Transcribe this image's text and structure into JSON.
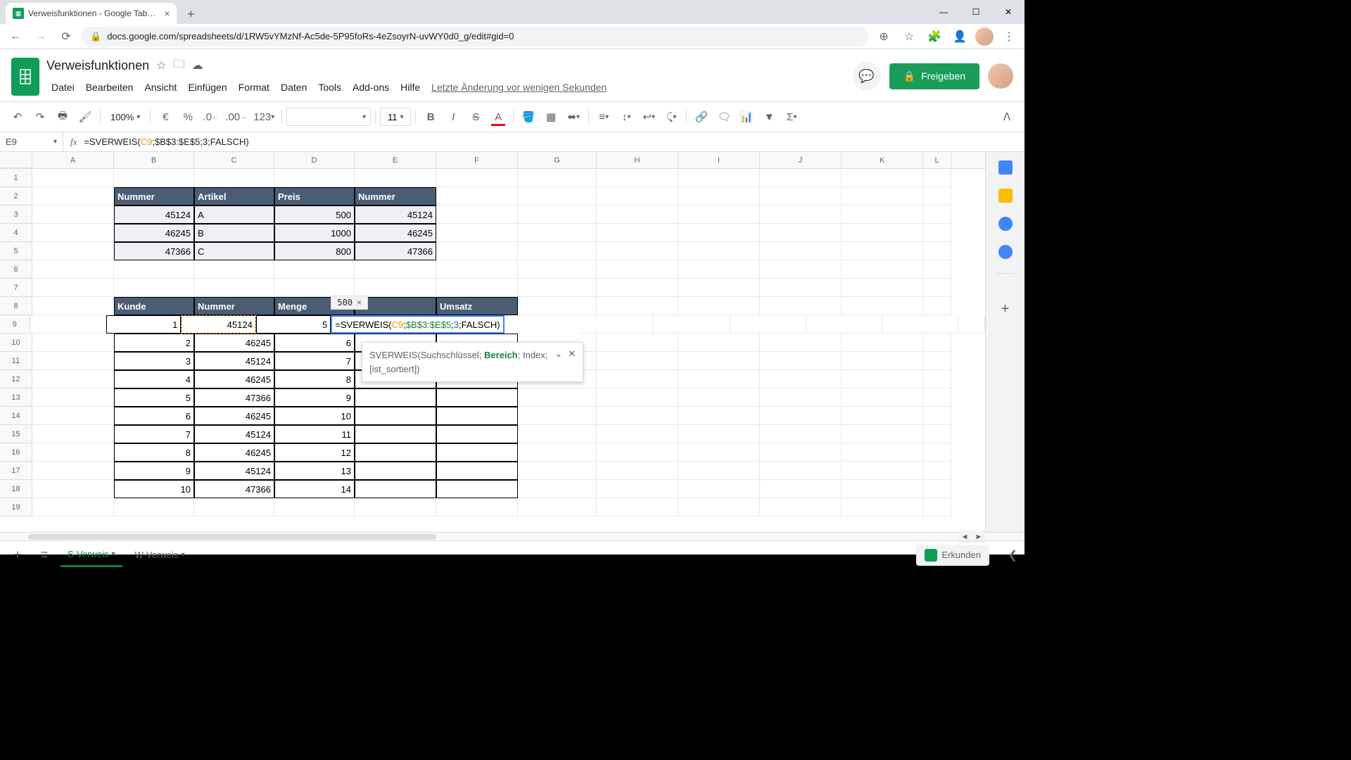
{
  "browser": {
    "tab_title": "Verweisfunktionen - Google Tab…",
    "url": "docs.google.com/spreadsheets/d/1RW5vYMzNf-Ac5de-5P95foRs-4eZsoyrN-uvWY0d0_g/edit#gid=0"
  },
  "doc": {
    "title": "Verweisfunktionen",
    "last_edit": "Letzte Änderung vor wenigen Sekunden",
    "share_label": "Freigeben"
  },
  "menus": [
    "Datei",
    "Bearbeiten",
    "Ansicht",
    "Einfügen",
    "Format",
    "Daten",
    "Tools",
    "Add-ons",
    "Hilfe"
  ],
  "toolbar": {
    "zoom": "100%",
    "currency": "€",
    "percent": "%",
    "dec_dec": ".0",
    "dec_inc": ".00",
    "numfmt": "123",
    "font": "",
    "size": "11"
  },
  "formula_bar": {
    "cell": "E9",
    "fx": "fx",
    "formula_prefix": "=SVERWEIS(",
    "formula_c9": "C9",
    "formula_sep1": ";",
    "formula_range": "$B$3:$E$5",
    "formula_sep2": ";",
    "formula_idx": "3",
    "formula_sep3": ";",
    "formula_false": "FALSCH",
    "formula_suffix": ")"
  },
  "columns": [
    "A",
    "B",
    "C",
    "D",
    "E",
    "F",
    "G",
    "H",
    "I",
    "J",
    "K",
    "L"
  ],
  "col_widths": [
    "w-A",
    "w-B",
    "w-C",
    "w-D",
    "w-E",
    "w-F",
    "w-G",
    "w-H",
    "w-I",
    "w-J",
    "w-K",
    "w-L"
  ],
  "table1": {
    "headers": [
      "Nummer",
      "Artikel",
      "Preis",
      "Nummer"
    ],
    "rows": [
      [
        "45124",
        "A",
        "500",
        "45124"
      ],
      [
        "46245",
        "B",
        "1000",
        "46245"
      ],
      [
        "47366",
        "C",
        "800",
        "47366"
      ]
    ]
  },
  "table2": {
    "headers": [
      "Kunde",
      "Nummer",
      "Menge",
      "",
      "Umsatz"
    ],
    "rows": [
      [
        "1",
        "45124",
        "5"
      ],
      [
        "2",
        "46245",
        "6"
      ],
      [
        "3",
        "45124",
        "7"
      ],
      [
        "4",
        "46245",
        "8"
      ],
      [
        "5",
        "47366",
        "9"
      ],
      [
        "6",
        "46245",
        "10"
      ],
      [
        "7",
        "45124",
        "11"
      ],
      [
        "8",
        "46245",
        "12"
      ],
      [
        "9",
        "45124",
        "13"
      ],
      [
        "10",
        "47366",
        "14"
      ]
    ]
  },
  "editing": {
    "result_preview": "500",
    "formula_display": "=SVERWEIS(C9;$B$3:$E$5;3;FALSCH)"
  },
  "tooltip": {
    "text_prefix": "SVERWEIS(Suchschlüssel; ",
    "text_hl": "Bereich",
    "text_mid": "; Index; ",
    "text_suffix": "[ist_sortiert])"
  },
  "sheet_tabs": {
    "add": "+",
    "all": "≡",
    "tabs": [
      "S-Verweis",
      "W-Verweis"
    ],
    "active": 0,
    "explore": "Erkunden"
  }
}
